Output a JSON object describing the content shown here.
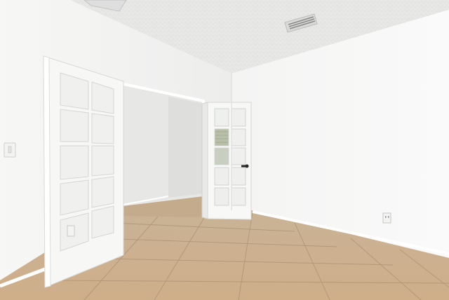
{
  "scene": {
    "description_colors": {
      "ceiling": "#e6e6e4",
      "left_wall": "#f2f2f1",
      "right_wall": "#f6f6f5",
      "back_wall": "#ececea",
      "closet_interior": "#e9e9e7",
      "floor_tile": "#c8ae8f",
      "floor_grout": "#a58d72",
      "door_frame": "#ffffff",
      "glass": "#f4f4f3",
      "baseboard": "#ffffff"
    }
  }
}
